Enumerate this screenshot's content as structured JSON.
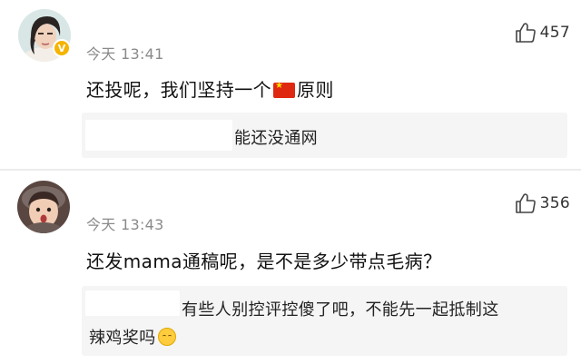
{
  "comments": [
    {
      "time": "今天 13:41",
      "likes": "457",
      "text_before_flag": "还投呢，我们坚持一个",
      "text_after_flag": "原则",
      "reply_line1": "能还没通网",
      "avatar_icon": "avatar-photo-girl",
      "verified_icon": "verified-badge-icon"
    },
    {
      "time": "今天 13:43",
      "likes": "356",
      "text": "还发mama通稿呢，是不是多少带点毛病？",
      "reply_line1": "有些人别控评控傻了吧，不能先一起抵制这",
      "reply_line2": "辣鸡奖吗",
      "avatar_icon": "avatar-photo-child"
    }
  ],
  "colors": {
    "time_gray": "#8a8a8a",
    "reply_bg": "#f5f5f5",
    "verified": "#f5b400",
    "flag_red": "#de2910"
  }
}
